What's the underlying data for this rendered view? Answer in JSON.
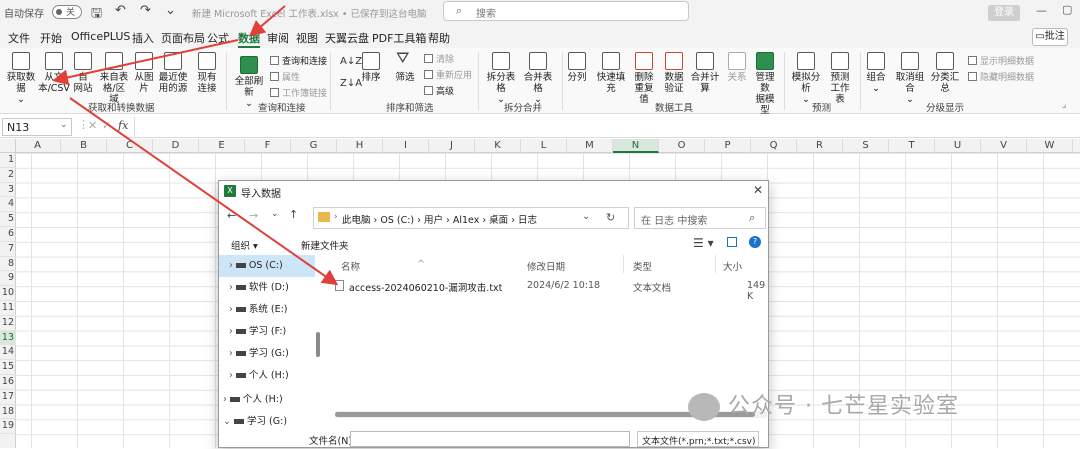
{
  "titlebar": {
    "autosave_label": "自动保存",
    "autosave_state": "关",
    "filename": "新建 Microsoft Excel 工作表.xlsx • 已保存到这台电脑",
    "search_placeholder": "搜索",
    "login_label": "登录"
  },
  "menu": {
    "items": [
      "文件",
      "开始",
      "OfficePLUS",
      "插入",
      "页面布局",
      "公式",
      "数据",
      "审阅",
      "视图",
      "天翼云盘",
      "PDF工具箱",
      "帮助"
    ],
    "active": "数据",
    "comment_label": "批注"
  },
  "ribbon": {
    "get_data": "获取数据",
    "from_text_line1": "从文",
    "from_text_line2": "本/CSV",
    "from_web_line1": "自",
    "from_web_line2": "网站",
    "from_table_line1": "来自表",
    "from_table_line2": "格/区域",
    "from_picture_line1": "从图",
    "from_picture_line2": "片",
    "recent_sources_line1": "最近使",
    "recent_sources_line2": "用的源",
    "existing_conn_line1": "现有",
    "existing_conn_line2": "连接",
    "group_get_transform": "获取和转换数据",
    "refresh_all": "全部刷新",
    "queries_connections": "查询和连接",
    "properties": "属性",
    "edit_links": "工作簿链接",
    "group_queries": "查询和连接",
    "sort": "排序",
    "filter": "筛选",
    "clear": "清除",
    "reapply": "重新应用",
    "advanced": "高级",
    "group_sort_filter": "排序和筛选",
    "split_table": "拆分表格",
    "merge_table": "合并表格",
    "group_split_merge": "拆分合并",
    "text_to_columns": "分列",
    "flash_fill": "快速填充",
    "remove_dup_line1": "删除",
    "remove_dup_line2": "重复值",
    "data_validation": "数据验证",
    "consolidate": "合并计算",
    "relationships": "关系",
    "manage_model_line1": "管理数",
    "manage_model_line2": "据模型",
    "group_data_tools": "数据工具",
    "what_if": "模拟分析",
    "forecast_line1": "预测",
    "forecast_line2": "工作表",
    "group_forecast": "预测",
    "group_btn": "组合",
    "ungroup": "取消组合",
    "subtotal": "分类汇总",
    "show_detail": "显示明细数据",
    "hide_detail": "隐藏明细数据",
    "group_outline": "分级显示"
  },
  "formula_bar": {
    "name_box": "N13",
    "fx": "fx"
  },
  "grid": {
    "columns": [
      "A",
      "B",
      "C",
      "D",
      "E",
      "F",
      "G",
      "H",
      "I",
      "J",
      "K",
      "L",
      "M",
      "N",
      "O",
      "P",
      "Q",
      "R",
      "S",
      "T",
      "U",
      "V",
      "W"
    ],
    "selected_column": "N",
    "rows": [
      "1",
      "2",
      "3",
      "4",
      "5",
      "6",
      "7",
      "8",
      "9",
      "10",
      "11",
      "12",
      "13",
      "14",
      "15",
      "16",
      "17",
      "18",
      "19"
    ],
    "selected_row": "13"
  },
  "dialog": {
    "title": "导入数据",
    "breadcrumb": [
      "此电脑",
      "OS (C:)",
      "用户",
      "Al1ex",
      "桌面",
      "日志"
    ],
    "search_placeholder": "在 日志 中搜索",
    "organize": "组织",
    "new_folder": "新建文件夹",
    "sidebar": [
      {
        "label": "OS (C:)",
        "selected": true
      },
      {
        "label": "软件 (D:)",
        "selected": false
      },
      {
        "label": "系统 (E:)",
        "selected": false
      },
      {
        "label": "学习 (F:)",
        "selected": false
      },
      {
        "label": "学习 (G:)",
        "selected": false
      },
      {
        "label": "个人 (H:)",
        "selected": false
      },
      {
        "label": "个人 (H:)",
        "selected": false
      },
      {
        "label": "学习 (G:)",
        "selected": false
      }
    ],
    "columns": {
      "name": "名称",
      "modified": "修改日期",
      "type": "类型",
      "size": "大小"
    },
    "files": [
      {
        "name": "access-2024060210-漏洞攻击.txt",
        "modified": "2024/6/2 10:18",
        "type": "文本文档",
        "size": "149 K"
      }
    ],
    "filename_label": "文件名(N):",
    "filename_value": "",
    "filetype_value": "文本文件(*.prn;*.txt;*.csv)"
  },
  "watermark": {
    "text": "公众号 · 七芒星实验室"
  },
  "colors": {
    "excel_green": "#1f7a3e",
    "arrow_red": "#e0403a",
    "selection_blue": "#cde6f7"
  }
}
